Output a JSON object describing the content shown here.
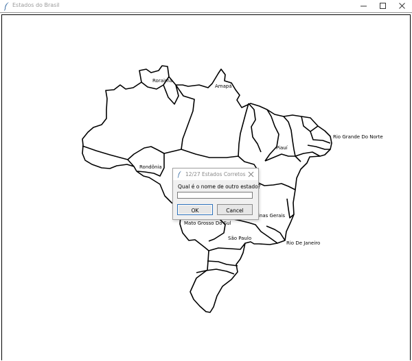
{
  "window": {
    "title": "Estados do Brasil",
    "icons": {
      "app": "feather-icon",
      "minimize": "minimize-icon",
      "maximize": "maximize-icon",
      "close": "close-icon"
    }
  },
  "map": {
    "labels": {
      "roraima": "Roraima",
      "amapa": "Amapá",
      "rio_grande_do_norte": "Rio Grande Do Norte",
      "piaui": "Piauí",
      "rondonia": "Rondônia",
      "minas_gerais": "inas Gerais",
      "mato_grosso_do_sul": "Mato Grosso Do Sul",
      "sao_paulo": "São Paulo",
      "rio_de_janeiro": "Rio De Janeiro"
    }
  },
  "dialog": {
    "title": "12/27 Estados Corretos",
    "prompt": "Qual é o nome de outro estado?",
    "input_value": "",
    "ok_label": "OK",
    "cancel_label": "Cancel"
  },
  "colors": {
    "map_stroke": "#000000",
    "ok_focus": "#2a6fb8"
  }
}
